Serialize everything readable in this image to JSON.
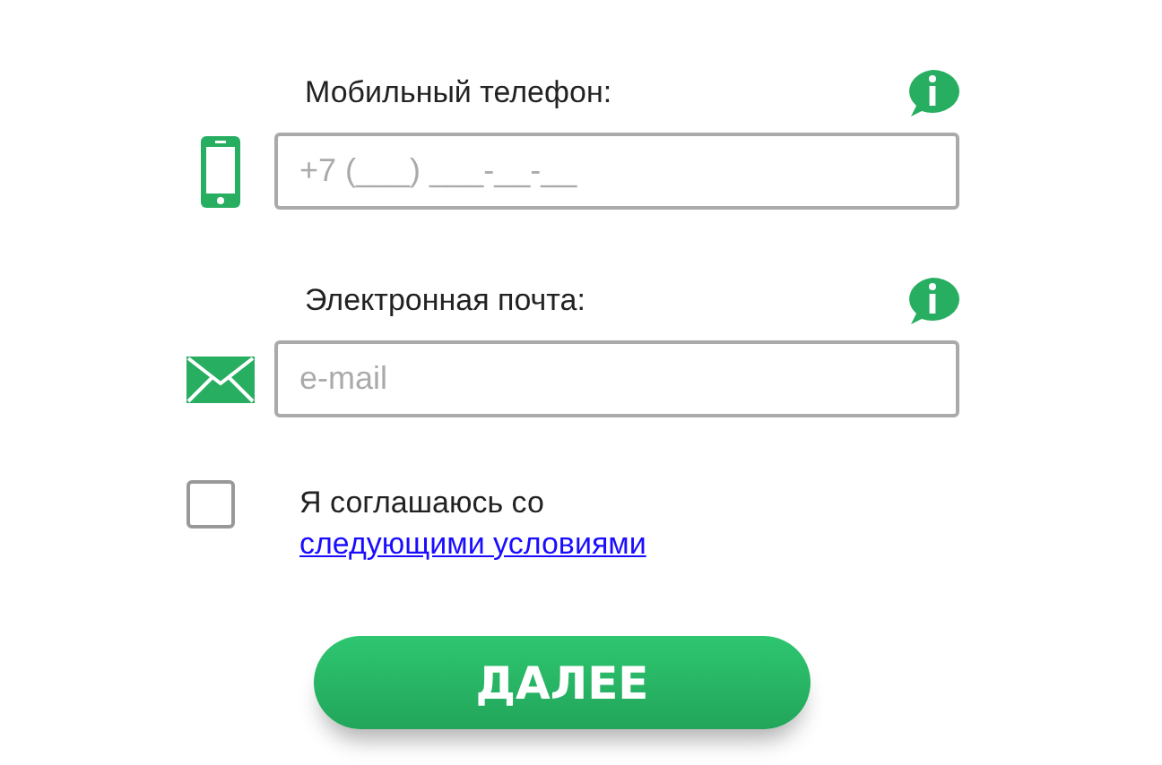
{
  "fields": [
    {
      "kind": "phone",
      "label": "Мобильный телефон:",
      "placeholder": "+7 (___) ___-__-__"
    },
    {
      "kind": "email",
      "label": "Электронная почта:",
      "placeholder": "e-mail"
    }
  ],
  "agreement": {
    "checked": false,
    "text": "Я соглашаюсь со",
    "link": "следующими условиями"
  },
  "submit": {
    "label": "ДАЛЕЕ"
  }
}
